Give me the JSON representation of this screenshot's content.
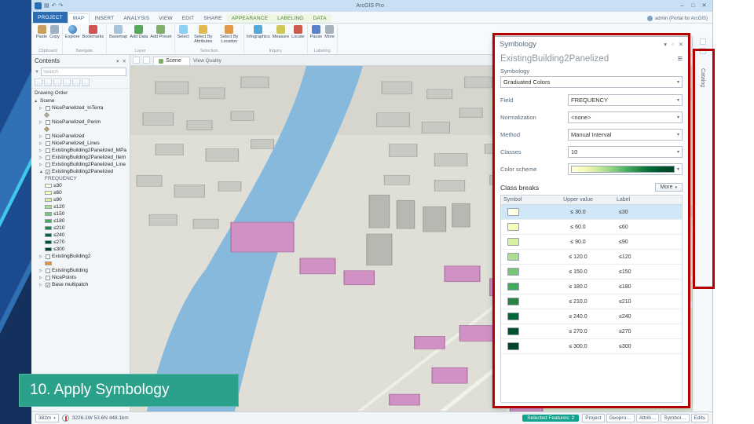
{
  "slide": {
    "caption": "10. Apply Symbology",
    "caption_bg": "#2BA18C",
    "highlight_color": "#B30000"
  },
  "window": {
    "title": "ArcGIS Pro",
    "signin": "admin (Portal for ArcGIS)",
    "controls": {
      "minimize": "–",
      "maximize": "□",
      "close": "✕"
    }
  },
  "ribbon": {
    "tabs": [
      {
        "label": "PROJECT",
        "primary": true
      },
      {
        "label": "MAP",
        "active": true
      },
      {
        "label": "INSERT"
      },
      {
        "label": "ANALYSIS"
      },
      {
        "label": "VIEW"
      },
      {
        "label": "EDIT"
      },
      {
        "label": "SHARE"
      },
      {
        "label": "APPEARANCE",
        "contextual": true
      },
      {
        "label": "LABELING",
        "contextual": true
      },
      {
        "label": "DATA",
        "contextual": true
      }
    ],
    "groups": [
      {
        "label": "Clipboard",
        "buttons": [
          {
            "label": "Paste",
            "icon": "paste"
          },
          {
            "label": "Copy",
            "icon": "copy"
          }
        ]
      },
      {
        "label": "Navigate",
        "buttons": [
          {
            "label": "Explore",
            "icon": "explore"
          },
          {
            "label": "Bookmarks",
            "icon": "bookmarks"
          }
        ]
      },
      {
        "label": "Layer",
        "buttons": [
          {
            "label": "Basemap",
            "icon": "basemap"
          },
          {
            "label": "Add Data",
            "icon": "add-data"
          },
          {
            "label": "Add Preset",
            "icon": "add-preset"
          }
        ]
      },
      {
        "label": "Selection",
        "buttons": [
          {
            "label": "Select",
            "icon": "select"
          },
          {
            "label": "Select By Attributes",
            "icon": "select-attributes"
          },
          {
            "label": "Select By Location",
            "icon": "select-location"
          }
        ]
      },
      {
        "label": "Inquiry",
        "buttons": [
          {
            "label": "Infographics",
            "icon": "infographics"
          },
          {
            "label": "Measure",
            "icon": "measure"
          },
          {
            "label": "Locate",
            "icon": "locate"
          }
        ]
      },
      {
        "label": "Labeling",
        "buttons": [
          {
            "label": "Pause",
            "icon": "pause"
          },
          {
            "label": "More",
            "icon": "more"
          }
        ]
      }
    ]
  },
  "contents": {
    "title": "Contents",
    "search_placeholder": "Search",
    "section": "Drawing Order",
    "tree": [
      {
        "t": "group",
        "label": "Scene",
        "level": 0
      },
      {
        "t": "layer",
        "label": "NicePanelized_InTerra",
        "checked": false,
        "level": 1
      },
      {
        "t": "diamond",
        "color": "#b8b0a4",
        "level": 2
      },
      {
        "t": "layer",
        "label": "NicePanelized_Perim",
        "checked": false,
        "level": 1
      },
      {
        "t": "diamond",
        "color": "#c8a064",
        "level": 2
      },
      {
        "t": "layer",
        "label": "NicePanelized",
        "checked": false,
        "level": 1
      },
      {
        "t": "layer",
        "label": "NicePanelized_Lines",
        "checked": false,
        "level": 1
      },
      {
        "t": "layer",
        "label": "ExistingBuilding2Panelized_MPa",
        "checked": false,
        "level": 1
      },
      {
        "t": "layer",
        "label": "ExistingBuilding2Panelized_Item",
        "checked": false,
        "level": 1
      },
      {
        "t": "layer",
        "label": "ExistingBuilding2Panelized_Line",
        "checked": false,
        "level": 1
      },
      {
        "t": "layer",
        "label": "ExistingBuilding2Panelized",
        "checked": true,
        "expanded": true,
        "level": 1
      },
      {
        "t": "field",
        "label": "FREQUENCY",
        "level": 2
      },
      {
        "t": "legend",
        "color": "#FFFFE5",
        "label": "≤30",
        "level": 2
      },
      {
        "t": "legend",
        "color": "#F7FCB9",
        "label": "≤60",
        "level": 2
      },
      {
        "t": "legend",
        "color": "#D9F0A3",
        "label": "≤90",
        "level": 2
      },
      {
        "t": "legend",
        "color": "#ADDD8E",
        "label": "≤120",
        "level": 2
      },
      {
        "t": "legend",
        "color": "#78C679",
        "label": "≤150",
        "level": 2
      },
      {
        "t": "legend",
        "color": "#41AB5D",
        "label": "≤180",
        "level": 2
      },
      {
        "t": "legend",
        "color": "#238443",
        "label": "≤210",
        "level": 2
      },
      {
        "t": "legend",
        "color": "#006837",
        "label": "≤240",
        "level": 2
      },
      {
        "t": "legend",
        "color": "#00522C",
        "label": "≤270",
        "level": 2
      },
      {
        "t": "legend",
        "color": "#004529",
        "label": "≤300",
        "level": 2
      },
      {
        "t": "layer",
        "label": "ExistingBuilding2",
        "checked": false,
        "level": 1
      },
      {
        "t": "legend",
        "color": "#E8913B",
        "label": "",
        "level": 2
      },
      {
        "t": "layer",
        "label": "ExistingBuilding",
        "checked": false,
        "level": 1
      },
      {
        "t": "layer",
        "label": "NicePoints",
        "checked": false,
        "level": 1
      },
      {
        "t": "layer",
        "label": "Base multipatch",
        "checked": true,
        "level": 1
      }
    ]
  },
  "scene": {
    "tab": "Scene",
    "view_quality": "View Quality"
  },
  "symbology": {
    "title": "Symbology",
    "layer_name": "ExistingBuilding2Panelized",
    "section_label": "Symbology",
    "primary_method": "Graduated Colors",
    "fields": [
      {
        "label": "Field",
        "value": "FREQUENCY"
      },
      {
        "label": "Normalization",
        "value": "<none>"
      },
      {
        "label": "Method",
        "value": "Manual Interval"
      },
      {
        "label": "Classes",
        "value": "10"
      }
    ],
    "color_scheme_label": "Color scheme",
    "class_breaks": {
      "heading": "Class breaks",
      "more_label": "More",
      "columns": [
        "Symbol",
        "Upper value",
        "Label"
      ],
      "rows": [
        {
          "color": "#FFFFE5",
          "upper": "≤ 30.0",
          "label": "≤30",
          "selected": true
        },
        {
          "color": "#F7FCB9",
          "upper": "≤ 60.0",
          "label": "≤60"
        },
        {
          "color": "#D9F0A3",
          "upper": "≤ 90.0",
          "label": "≤90"
        },
        {
          "color": "#ADDD8E",
          "upper": "≤ 120.0",
          "label": "≤120"
        },
        {
          "color": "#78C679",
          "upper": "≤ 150.0",
          "label": "≤150"
        },
        {
          "color": "#41AB5D",
          "upper": "≤ 180.0",
          "label": "≤180"
        },
        {
          "color": "#238443",
          "upper": "≤ 210.0",
          "label": "≤210"
        },
        {
          "color": "#006837",
          "upper": "≤ 240.0",
          "label": "≤240"
        },
        {
          "color": "#00522C",
          "upper": "≤ 270.0",
          "label": "≤270"
        },
        {
          "color": "#004529",
          "upper": "≤ 300.0",
          "label": "≤300"
        }
      ]
    }
  },
  "right_strip": {
    "label": "Catalog"
  },
  "statusbar": {
    "scale": "382m",
    "coords": "3226.1W 53.6N 448.1km",
    "selection_chip": "Selected Features: 2",
    "buttons": [
      "Project",
      "Geopro…",
      "Attrib…",
      "Symbol…",
      "Edits"
    ]
  }
}
